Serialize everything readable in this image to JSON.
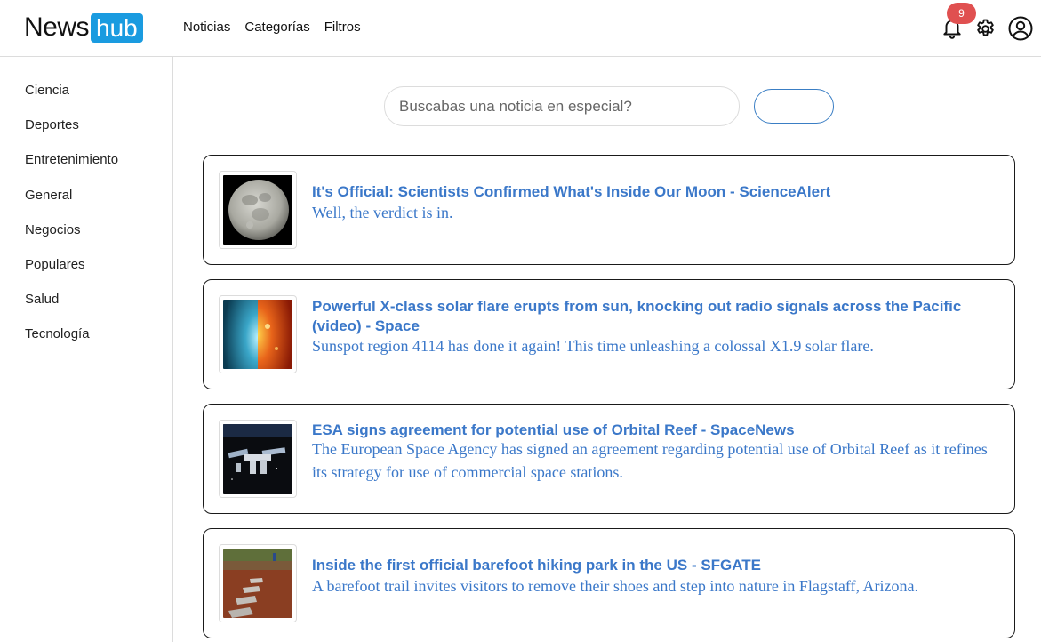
{
  "brand": {
    "news": "News",
    "hub": "hub"
  },
  "nav": [
    "Noticias",
    "Categorías",
    "Filtros"
  ],
  "notifications": {
    "count": "9"
  },
  "sidebar": {
    "items": [
      "Ciencia",
      "Deportes",
      "Entretenimiento",
      "General",
      "Negocios",
      "Populares",
      "Salud",
      "Tecnología"
    ]
  },
  "search": {
    "placeholder": "Buscabas una noticia en especial?",
    "value": "",
    "button_label": ""
  },
  "articles": [
    {
      "title": "It's Official: Scientists Confirmed What's Inside Our Moon - ScienceAlert",
      "description": "Well, the verdict is in.",
      "thumbnail": "moon-photo"
    },
    {
      "title": "Powerful X-class solar flare erupts from sun, knocking out radio signals across the Pacific (video) - Space",
      "description": "Sunspot region 4114 has done it again! This time unleashing a colossal X1.9 solar flare.",
      "thumbnail": "solar-flare-photo"
    },
    {
      "title": "ESA signs agreement for potential use of Orbital Reef - SpaceNews",
      "description": "The European Space Agency has signed an agreement regarding potential use of Orbital Reef as it refines its strategy for use of commercial space stations.",
      "thumbnail": "space-station-photo"
    },
    {
      "title": "Inside the first official barefoot hiking park in the US - SFGATE",
      "description": "A barefoot trail invites visitors to remove their shoes and step into nature in Flagstaff, Arizona.",
      "thumbnail": "barefoot-trail-photo"
    }
  ],
  "colors": {
    "accent": "#3b78c9",
    "brand": "#1a9be0",
    "badge": "#e05050"
  }
}
